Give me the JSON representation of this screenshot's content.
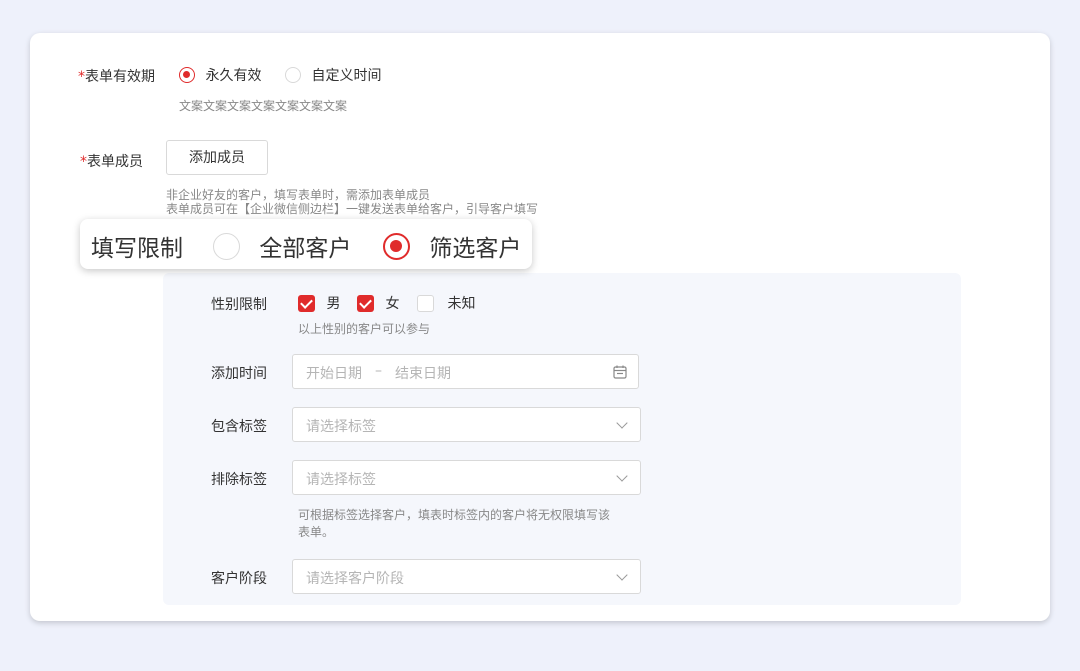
{
  "validity": {
    "required_mark": "*",
    "label": "表单有效期",
    "options": [
      {
        "label": "永久有效",
        "selected": true
      },
      {
        "label": "自定义时间",
        "selected": false
      }
    ],
    "hint": "文案文案文案文案文案文案文案"
  },
  "members": {
    "required_mark": "*",
    "label": "表单成员",
    "add_button": "添加成员",
    "hint_line1": "非企业好友的客户，填写表单时，需添加表单成员",
    "hint_line2": "表单成员可在【企业微信侧边栏】一键发送表单给客户，引导客户填写"
  },
  "limit": {
    "label": "填写限制",
    "options": [
      {
        "label": "全部客户",
        "selected": false
      },
      {
        "label": "筛选客户",
        "selected": true
      }
    ]
  },
  "filter": {
    "gender": {
      "label": "性别限制",
      "options": [
        {
          "label": "男",
          "checked": true
        },
        {
          "label": "女",
          "checked": true
        },
        {
          "label": "未知",
          "checked": false
        }
      ],
      "hint": "以上性别的客户可以参与"
    },
    "add_time": {
      "label": "添加时间",
      "start_placeholder": "开始日期",
      "separator": "–",
      "end_placeholder": "结束日期",
      "icon": "calendar-icon"
    },
    "include_tags": {
      "label": "包含标签",
      "placeholder": "请选择标签"
    },
    "exclude_tags": {
      "label": "排除标签",
      "placeholder": "请选择标签",
      "hint_line1": "可根据标签选择客户，填表时标签内的客户将无权限填写该",
      "hint_line2": "表单。"
    },
    "stage": {
      "label": "客户阶段",
      "placeholder": "请选择客户阶段"
    }
  },
  "colors": {
    "accent": "#e02b2b",
    "panel": "#f5f7fc",
    "background": "#eef1fb"
  }
}
